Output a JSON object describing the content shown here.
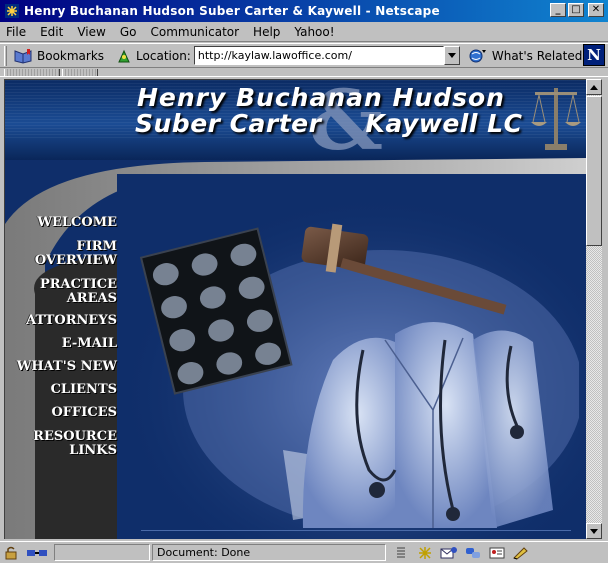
{
  "window": {
    "title": "Henry Buchanan Hudson Suber Carter & Kaywell - Netscape",
    "buttons": {
      "minimize": "_",
      "maximize": "□",
      "close": "✕"
    }
  },
  "menu": [
    {
      "label": "File"
    },
    {
      "label": "Edit"
    },
    {
      "label": "View"
    },
    {
      "label": "Go"
    },
    {
      "label": "Communicator"
    },
    {
      "label": "Help"
    },
    {
      "label": "Yahoo!"
    }
  ],
  "toolbar": {
    "bookmarks_label": "Bookmarks",
    "location_label": "Location:",
    "location_value": "http://kaylaw.lawoffice.com/",
    "related_label": "What's Related",
    "brand_letter": "N"
  },
  "page": {
    "firm_name_line1": "Henry Buchanan Hudson",
    "firm_name_line2": "Suber Carter",
    "firm_name_amp": "&",
    "firm_name_line2b": "Kaywell LC",
    "nav": [
      {
        "label": "WELCOME"
      },
      {
        "label": "FIRM\nOVERVIEW"
      },
      {
        "label": "PRACTICE\nAREAS"
      },
      {
        "label": "ATTORNEYS"
      },
      {
        "label": "E-MAIL"
      },
      {
        "label": "WHAT'S NEW"
      },
      {
        "label": "CLIENTS"
      },
      {
        "label": "OFFICES"
      },
      {
        "label": "RESOURCE\nLINKS"
      }
    ]
  },
  "status": {
    "text": "Document: Done"
  },
  "colors": {
    "title_bar": "#000080",
    "page_background": "#0f2e6a",
    "chrome": "#c0c0c0"
  },
  "icons": [
    "netscape-app-icon",
    "bookmarks-icon",
    "location-icon",
    "whats-related-icon",
    "netscape-n-logo",
    "security-lock-icon",
    "connection-icon",
    "component-icons"
  ]
}
